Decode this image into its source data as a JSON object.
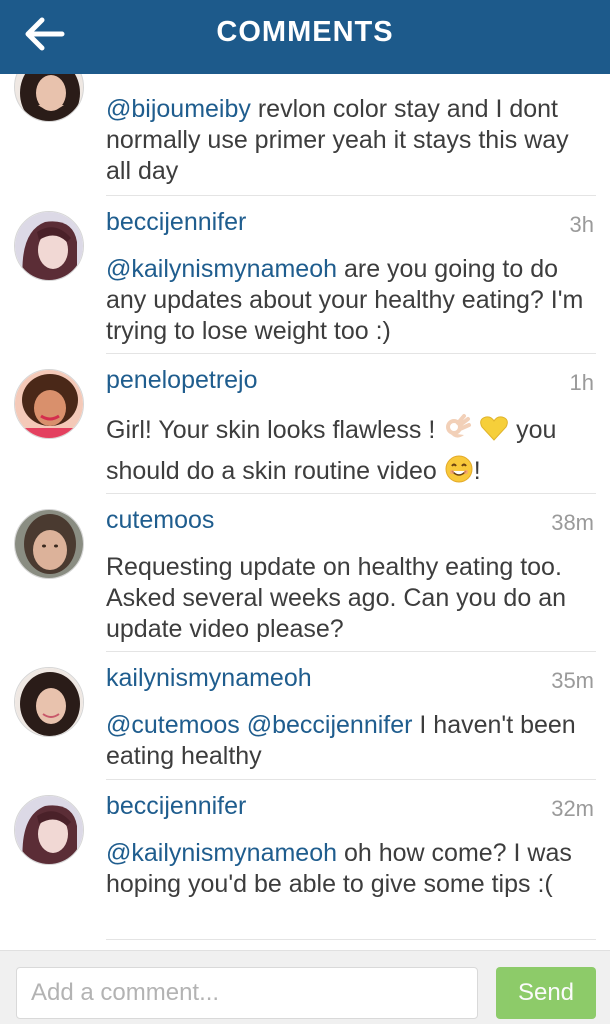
{
  "header": {
    "title": "COMMENTS",
    "back_icon": "back-arrow-icon"
  },
  "comments": [
    {
      "username": "",
      "time": "",
      "text_parts": [
        {
          "mention": "@bijoumeiby"
        },
        {
          "text": " revlon color stay and I dont normally use primer yeah it stays this way all day"
        }
      ]
    },
    {
      "username": "beccijennifer",
      "time": "3h",
      "text_parts": [
        {
          "mention": "@kailynismynameoh"
        },
        {
          "text": " are you going to do any updates about your healthy eating? I'm trying to lose weight too :)"
        }
      ]
    },
    {
      "username": "penelopetrejo",
      "time": "1h",
      "text_parts": [
        {
          "text": "Girl! Your skin looks flawless ! "
        },
        {
          "emoji": "ok-hand-emoji"
        },
        {
          "text": " "
        },
        {
          "emoji": "yellow-heart-emoji"
        },
        {
          "text": " you should do a skin routine video "
        },
        {
          "emoji": "smiling-face-emoji"
        },
        {
          "text": "!"
        }
      ]
    },
    {
      "username": "cutemoos",
      "time": "38m",
      "text_parts": [
        {
          "text": "Requesting update on healthy eating too.  Asked several weeks ago.  Can you do an update video please?"
        }
      ]
    },
    {
      "username": "kailynismynameoh",
      "time": "35m",
      "text_parts": [
        {
          "mention": "@cutemoos"
        },
        {
          "text": " "
        },
        {
          "mention": "@beccijennifer"
        },
        {
          "text": " I haven't been eating healthy"
        }
      ]
    },
    {
      "username": "beccijennifer",
      "time": "32m",
      "text_parts": [
        {
          "mention": "@kailynismynameoh"
        },
        {
          "text": " oh how come? I was hoping you'd be able to give some tips :("
        }
      ]
    }
  ],
  "footer": {
    "input_placeholder": "Add a comment...",
    "input_value": "",
    "send_label": "Send"
  },
  "colors": {
    "header_bg": "#1d5a8b",
    "link": "#1f5d8e",
    "send_button": "#6cbf3d"
  }
}
